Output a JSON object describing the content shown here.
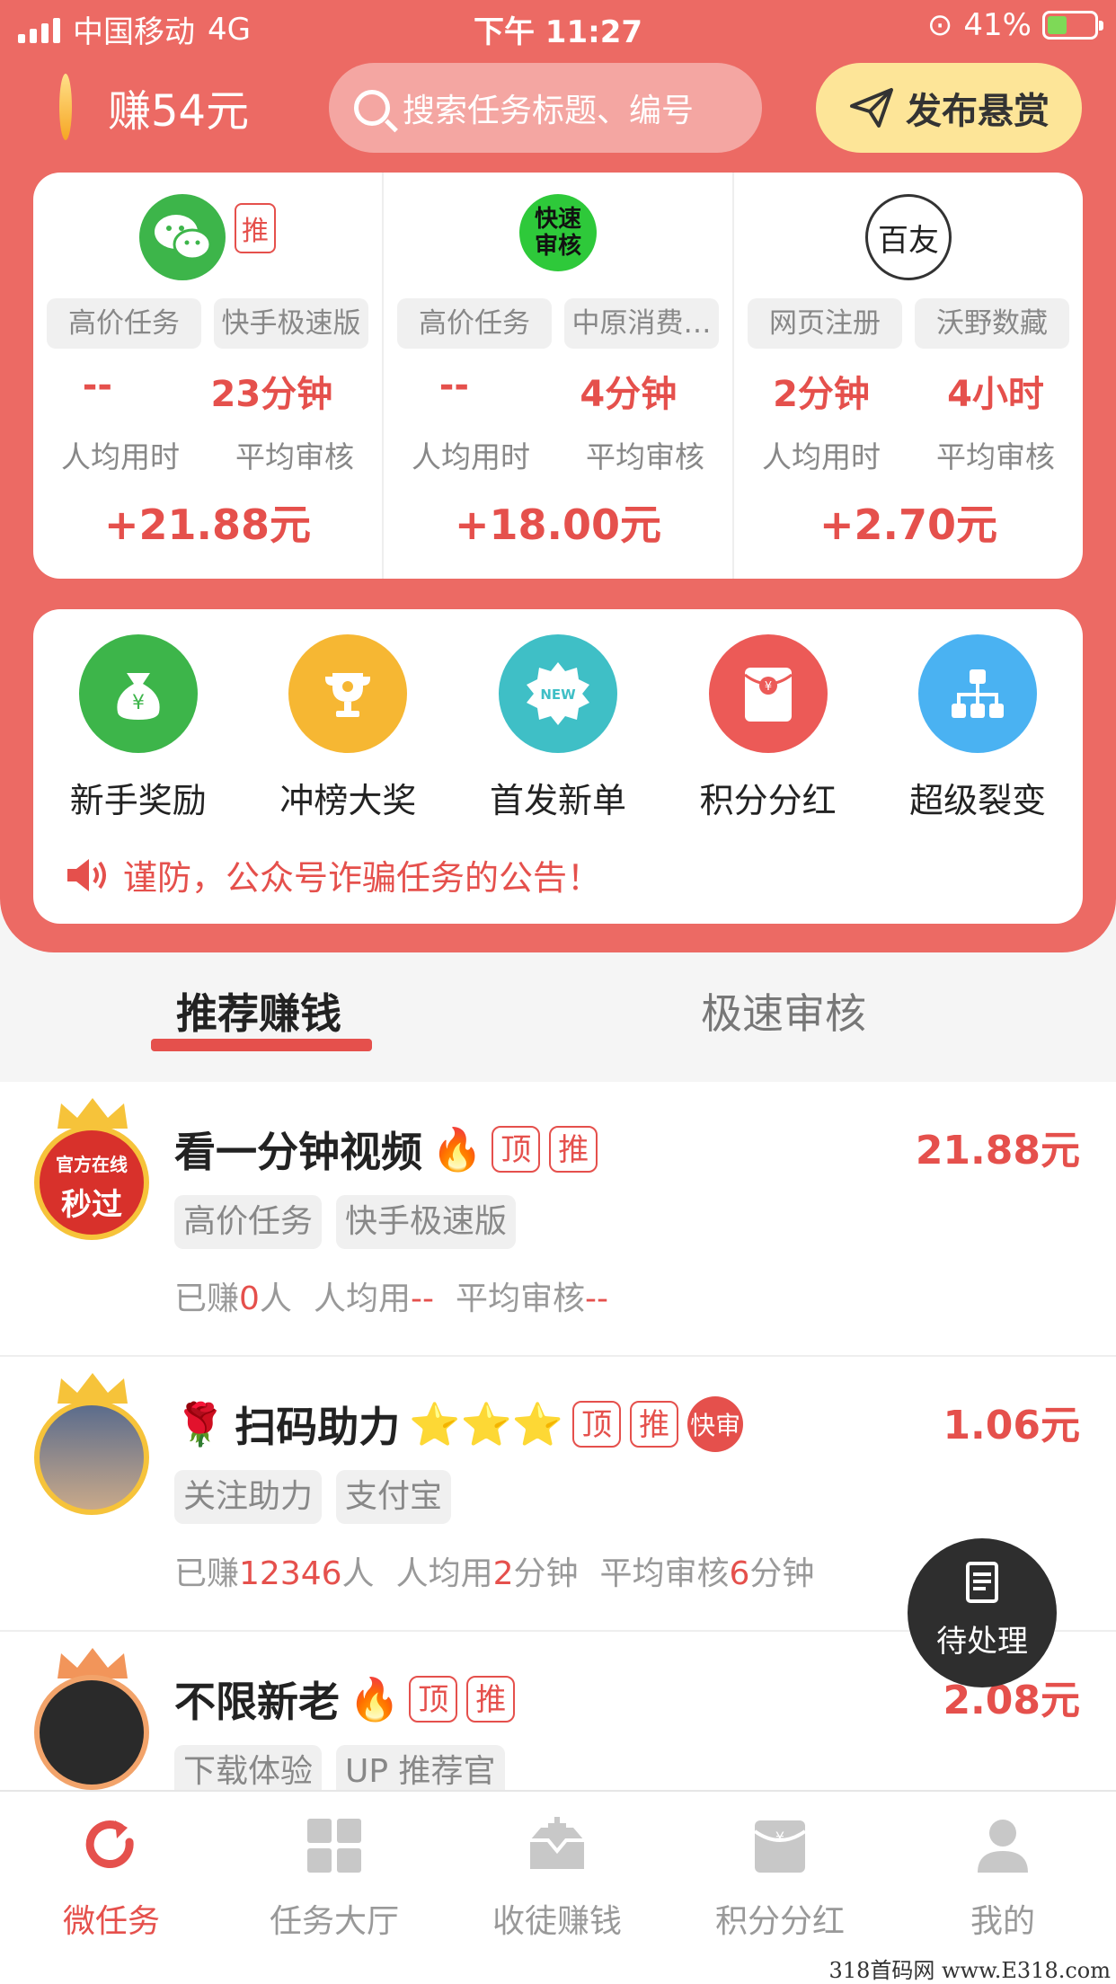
{
  "status": {
    "carrier": "中国移动",
    "network": "4G",
    "time": "下午 11:27",
    "battery": "41%"
  },
  "header": {
    "earned": "赚54元",
    "search_placeholder": "搜索任务标题、编号",
    "publish_label": "发布悬赏"
  },
  "featured": [
    {
      "logo": "wechat-icon",
      "logo_badge": "推",
      "tags": [
        "高价任务",
        "快手极速版"
      ],
      "time_avg": "--",
      "review_avg": "23分钟",
      "time_label": "人均用时",
      "review_label": "平均审核",
      "reward": "+21.88元"
    },
    {
      "logo": "kuaisu-shenhe-logo",
      "logo_text": "快速审核",
      "tags": [
        "高价任务",
        "中原消费…"
      ],
      "time_avg": "--",
      "review_avg": "4分钟",
      "time_label": "人均用时",
      "review_label": "平均审核",
      "reward": "+18.00元"
    },
    {
      "logo": "baiyou-logo",
      "logo_text": "百友",
      "tags": [
        "网页注册",
        "沃野数藏"
      ],
      "time_avg": "2分钟",
      "review_avg": "4小时",
      "time_label": "人均用时",
      "review_label": "平均审核",
      "reward": "+2.70元"
    }
  ],
  "actions": [
    {
      "label": "新手奖励",
      "icon": "money-bag-icon",
      "color": "#3db54a"
    },
    {
      "label": "冲榜大奖",
      "icon": "trophy-icon",
      "color": "#f6b733"
    },
    {
      "label": "首发新单",
      "icon": "new-badge-icon",
      "color": "#3fbfc6"
    },
    {
      "label": "积分分红",
      "icon": "red-envelope-icon",
      "color": "#ec5a57"
    },
    {
      "label": "超级裂变",
      "icon": "org-chart-icon",
      "color": "#4ab2f2"
    }
  ],
  "notice": "谨防，公众号诈骗任务的公告！",
  "tabs": [
    "推荐赚钱",
    "极速审核"
  ],
  "tasks": [
    {
      "title": "看一分钟视频",
      "emoji": "🔥",
      "badges": [
        "顶",
        "推"
      ],
      "price": "21.88元",
      "tags": [
        "高价任务",
        "快手极速版"
      ],
      "avatar_text": [
        "官方在线",
        "秒过"
      ],
      "s1": "已赚",
      "s1v": "0",
      "s1u": "人",
      "s2": "人均用",
      "s2v": "--",
      "s2u": "",
      "s3": "平均审核",
      "s3v": "--",
      "s3u": ""
    },
    {
      "title": "扫码助力",
      "prefix": "🌹",
      "emoji": "⭐⭐⭐",
      "badges": [
        "顶",
        "推"
      ],
      "fast": "快审",
      "price": "1.06元",
      "tags": [
        "关注助力",
        "支付宝"
      ],
      "s1": "已赚",
      "s1v": "12346",
      "s1u": "人",
      "s2": "人均用",
      "s2v": "2",
      "s2u": "分钟",
      "s3": "平均审核",
      "s3v": "6",
      "s3u": "分钟"
    },
    {
      "title": "不限新老",
      "emoji": "🔥",
      "badges": [
        "顶",
        "推"
      ],
      "price": "2.08元",
      "tags": [
        "下载体验",
        "UP 推荐官"
      ]
    }
  ],
  "pending_label": "待处理",
  "nav": [
    {
      "label": "微任务",
      "icon": "refresh-icon",
      "active": true
    },
    {
      "label": "任务大厅",
      "icon": "grid-icon"
    },
    {
      "label": "收徒赚钱",
      "icon": "inbox-plus-icon"
    },
    {
      "label": "积分分红",
      "icon": "red-envelope-icon"
    },
    {
      "label": "我的",
      "icon": "user-icon"
    }
  ],
  "watermark": "318首码网 www.E318.com"
}
